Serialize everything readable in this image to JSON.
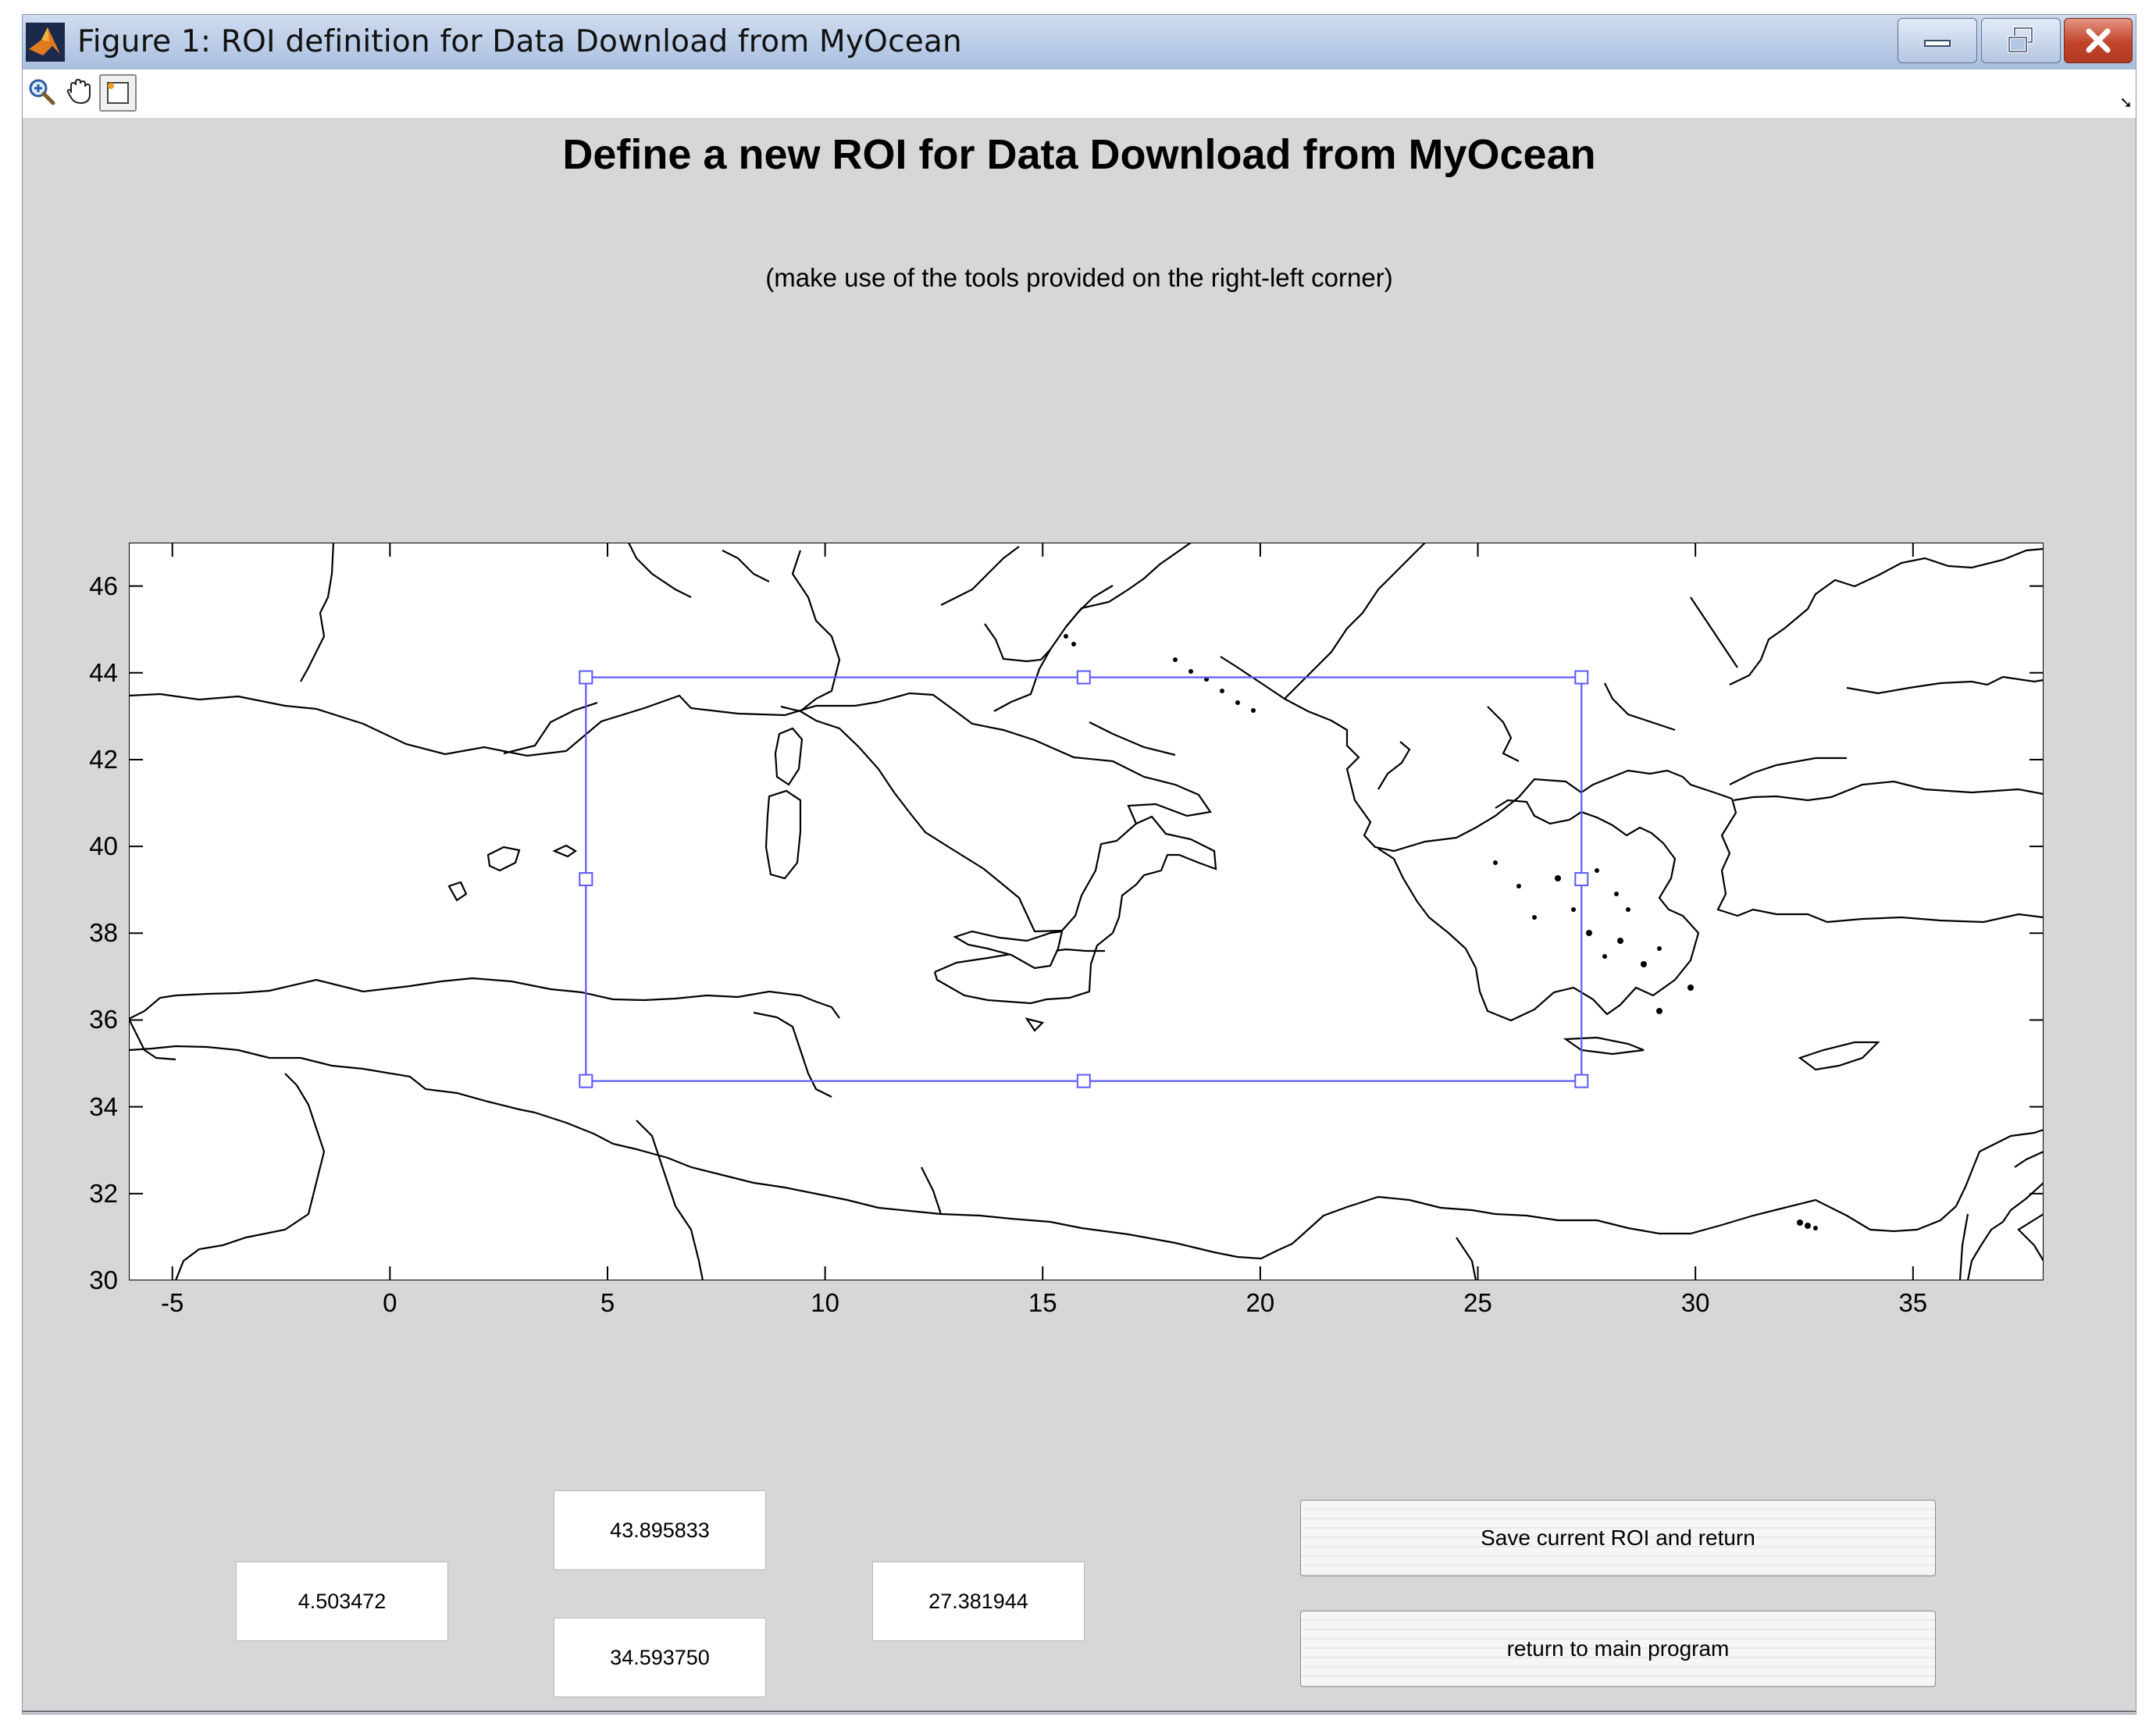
{
  "window": {
    "title": "Figure 1: ROI definition for Data Download from MyOcean",
    "controls": [
      "minimize-icon",
      "restore-icon",
      "close-icon"
    ]
  },
  "toolbar": {
    "tools": [
      "zoom-in-icon",
      "pan-icon",
      "roi-select-icon"
    ]
  },
  "header": {
    "title": "Define a new ROI for Data Download from MyOcean",
    "subtitle": "(make use of the tools provided on the right-left corner)"
  },
  "map": {
    "x_ticks": [
      "-5",
      "0",
      "5",
      "10",
      "15",
      "20",
      "25",
      "30",
      "35"
    ],
    "y_ticks": [
      "46",
      "44",
      "42",
      "40",
      "38",
      "36",
      "34",
      "32",
      "30"
    ],
    "xlim": [
      -6,
      38
    ],
    "ylim": [
      30,
      47
    ],
    "roi": {
      "west": 4.503472,
      "east": 27.381944,
      "south": 34.59375,
      "north": 43.895833
    },
    "colors": {
      "roi": "#5a5aff",
      "coastline": "#000000"
    }
  },
  "fields": {
    "north": "43.895833",
    "west": "4.503472",
    "south": "34.593750",
    "east": "27.381944"
  },
  "buttons": {
    "save_label": "Save current ROI and return",
    "return_label": "return to main program"
  }
}
